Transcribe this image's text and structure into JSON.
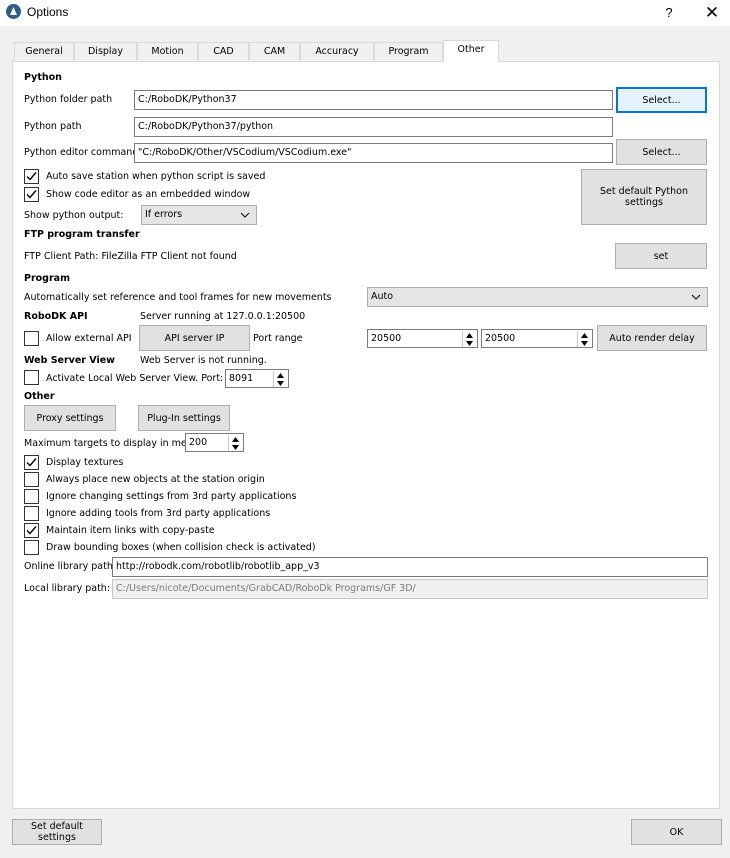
{
  "window": {
    "title": "Options",
    "help": "?",
    "close": "✕"
  },
  "tabs": [
    "General",
    "Display",
    "Motion",
    "CAD",
    "CAM",
    "Accuracy",
    "Program",
    "Other"
  ],
  "python": {
    "section": "Python",
    "folder_label": "Python folder path",
    "folder_value": "C:/RoboDK/Python37",
    "folder_select": "Select...",
    "path_label": "Python path",
    "path_value": "C:/RoboDK/Python37/python",
    "editor_label": "Python editor command",
    "editor_value": "\"C:/RoboDK/Other/VSCodium/VSCodium.exe\"",
    "editor_select": "Select...",
    "autosave_label": "Auto save station when python script is saved",
    "autosave_checked": true,
    "embedded_label": "Show code editor as an embedded window",
    "embedded_checked": true,
    "output_label": "Show python output:",
    "output_value": "If errors",
    "defaults_button": "Set default Python settings"
  },
  "ftp": {
    "section": "FTP program transfer",
    "client_label": "FTP Client Path: FileZilla FTP Client not found",
    "set_button": "set"
  },
  "program": {
    "section": "Program",
    "frames_label": "Automatically set reference and tool frames for new movements",
    "frames_value": "Auto"
  },
  "api": {
    "section": "RoboDK API",
    "status": "Server running at 127.0.0.1:20500",
    "allow_label": "Allow external API",
    "allow_checked": false,
    "server_ip_button": "API server IP",
    "port_range_label": "Port range",
    "port_from": "20500",
    "port_to": "20500",
    "render_delay_button": "Auto render delay"
  },
  "web": {
    "section": "Web Server View",
    "status": "Web Server is not running.",
    "activate_label": "Activate Local Web Server View. Port:",
    "activate_checked": false,
    "port": "8091"
  },
  "other": {
    "section": "Other",
    "proxy_button": "Proxy settings",
    "plugin_button": "Plug-In settings",
    "max_targets_label": "Maximum targets to display in menu",
    "max_targets_value": "200",
    "checks": [
      {
        "label": "Display textures",
        "checked": true
      },
      {
        "label": "Always place new objects at the station origin",
        "checked": false
      },
      {
        "label": "Ignore changing settings from 3rd party applications",
        "checked": false
      },
      {
        "label": "Ignore adding tools from 3rd party applications",
        "checked": false
      },
      {
        "label": "Maintain item links with copy-paste",
        "checked": true
      },
      {
        "label": "Draw bounding boxes (when collision check is activated)",
        "checked": false
      }
    ],
    "online_label": "Online library path:",
    "online_value": "http://robodk.com/robotlib/robotlib_app_v3",
    "local_label": "Local library path:",
    "local_value": "C:/Users/nicote/Documents/GrabCAD/RoboDk Programs/GF 3D/"
  },
  "footer": {
    "default_button": "Set default settings",
    "ok_button": "OK"
  },
  "colors": {
    "focus": "#0078d7",
    "panel": "#ffffff",
    "window": "#f0f0f0"
  }
}
